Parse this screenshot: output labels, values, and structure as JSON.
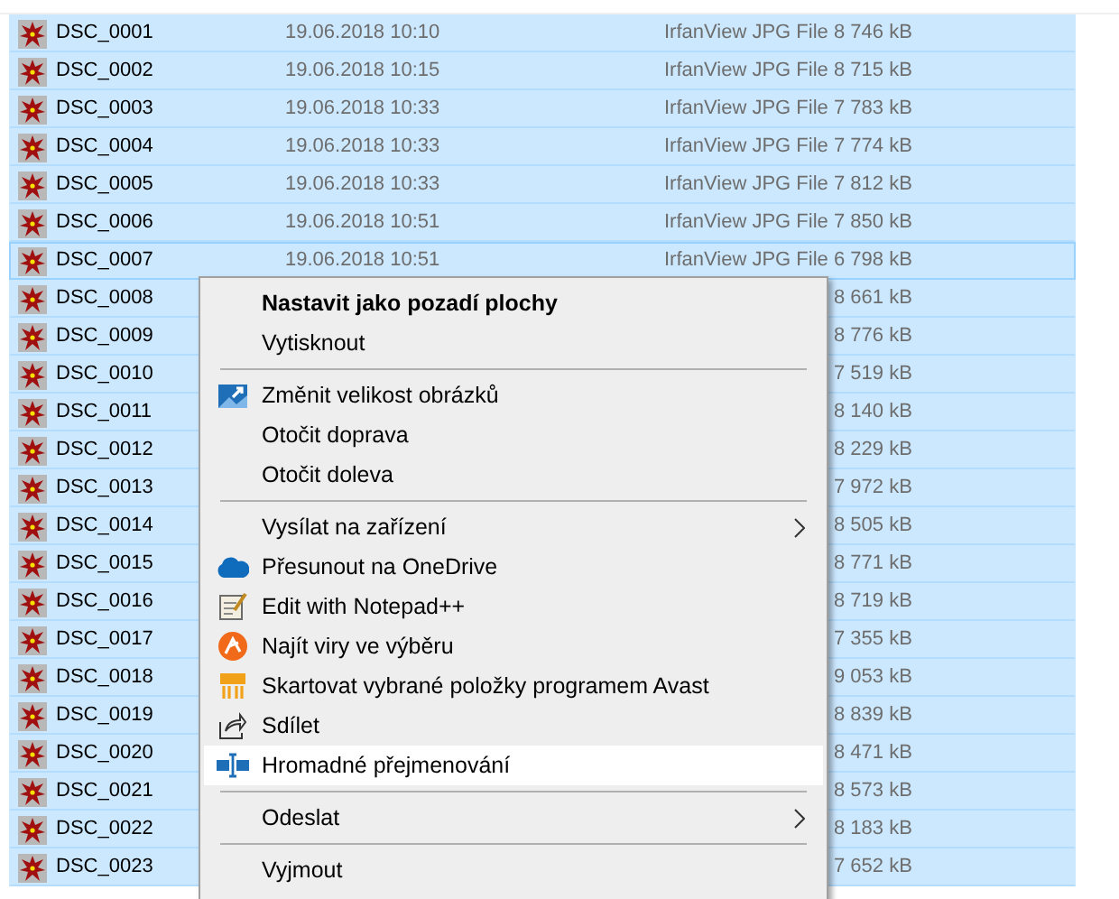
{
  "files": [
    {
      "name": "DSC_0001",
      "date": "19.06.2018 10:10",
      "type": "IrfanView JPG File",
      "size": "8 746 kB",
      "selected": true,
      "focused": false
    },
    {
      "name": "DSC_0002",
      "date": "19.06.2018 10:15",
      "type": "IrfanView JPG File",
      "size": "8 715 kB",
      "selected": true,
      "focused": false
    },
    {
      "name": "DSC_0003",
      "date": "19.06.2018 10:33",
      "type": "IrfanView JPG File",
      "size": "7 783 kB",
      "selected": true,
      "focused": false
    },
    {
      "name": "DSC_0004",
      "date": "19.06.2018 10:33",
      "type": "IrfanView JPG File",
      "size": "7 774 kB",
      "selected": true,
      "focused": false
    },
    {
      "name": "DSC_0005",
      "date": "19.06.2018 10:33",
      "type": "IrfanView JPG File",
      "size": "7 812 kB",
      "selected": true,
      "focused": false
    },
    {
      "name": "DSC_0006",
      "date": "19.06.2018 10:51",
      "type": "IrfanView JPG File",
      "size": "7 850 kB",
      "selected": true,
      "focused": false
    },
    {
      "name": "DSC_0007",
      "date": "19.06.2018 10:51",
      "type": "IrfanView JPG File",
      "size": "6 798 kB",
      "selected": true,
      "focused": true
    },
    {
      "name": "DSC_0008",
      "size": "8 661 kB",
      "selected": true,
      "focused": false
    },
    {
      "name": "DSC_0009",
      "size": "8 776 kB",
      "selected": true,
      "focused": false
    },
    {
      "name": "DSC_0010",
      "size": "7 519 kB",
      "selected": true,
      "focused": false
    },
    {
      "name": "DSC_0011",
      "size": "8 140 kB",
      "selected": true,
      "focused": false
    },
    {
      "name": "DSC_0012",
      "size": "8 229 kB",
      "selected": true,
      "focused": false
    },
    {
      "name": "DSC_0013",
      "size": "7 972 kB",
      "selected": true,
      "focused": false
    },
    {
      "name": "DSC_0014",
      "size": "8 505 kB",
      "selected": true,
      "focused": false
    },
    {
      "name": "DSC_0015",
      "size": "8 771 kB",
      "selected": true,
      "focused": false
    },
    {
      "name": "DSC_0016",
      "size": "8 719 kB",
      "selected": true,
      "focused": false
    },
    {
      "name": "DSC_0017",
      "size": "7 355 kB",
      "selected": true,
      "focused": false
    },
    {
      "name": "DSC_0018",
      "size": "9 053 kB",
      "selected": true,
      "focused": false
    },
    {
      "name": "DSC_0019",
      "size": "8 839 kB",
      "selected": true,
      "focused": false
    },
    {
      "name": "DSC_0020",
      "size": "8 471 kB",
      "selected": true,
      "focused": false
    },
    {
      "name": "DSC_0021",
      "size": "8 573 kB",
      "selected": true,
      "focused": false
    },
    {
      "name": "DSC_0022",
      "size": "8 183 kB",
      "selected": true,
      "focused": false
    },
    {
      "name": "DSC_0023",
      "size": "7 652 kB",
      "selected": true,
      "focused": false
    }
  ],
  "context_menu": [
    {
      "kind": "item",
      "label": "Nastavit jako pozadí plochy",
      "bold": true,
      "submenu": false,
      "selected": false
    },
    {
      "kind": "item",
      "label": "Vytisknout",
      "bold": false,
      "submenu": false,
      "selected": false
    },
    {
      "kind": "separator"
    },
    {
      "kind": "item",
      "label": "Změnit velikost obrázků",
      "bold": false,
      "submenu": false,
      "selected": false
    },
    {
      "kind": "item",
      "label": "Otočit doprava",
      "bold": false,
      "submenu": false,
      "selected": false
    },
    {
      "kind": "item",
      "label": "Otočit doleva",
      "bold": false,
      "submenu": false,
      "selected": false
    },
    {
      "kind": "separator"
    },
    {
      "kind": "item",
      "label": "Vysílat na zařízení",
      "bold": false,
      "submenu": true,
      "selected": false
    },
    {
      "kind": "item",
      "label": "Přesunout na OneDrive",
      "bold": false,
      "submenu": false,
      "selected": false
    },
    {
      "kind": "item",
      "label": "Edit with Notepad++",
      "bold": false,
      "submenu": false,
      "selected": false
    },
    {
      "kind": "item",
      "label": "Najít viry ve výběru",
      "bold": false,
      "submenu": false,
      "selected": false
    },
    {
      "kind": "item",
      "label": "Skartovat vybrané položky programem Avast",
      "bold": false,
      "submenu": false,
      "selected": false
    },
    {
      "kind": "item",
      "label": "Sdílet",
      "bold": false,
      "submenu": false,
      "selected": false
    },
    {
      "kind": "item",
      "label": "Hromadné přejmenování",
      "bold": false,
      "submenu": false,
      "selected": true
    },
    {
      "kind": "separator"
    },
    {
      "kind": "item",
      "label": "Odeslat",
      "bold": false,
      "submenu": true,
      "selected": false
    },
    {
      "kind": "separator"
    },
    {
      "kind": "item",
      "label": "Vyjmout",
      "bold": false,
      "submenu": false,
      "selected": false
    }
  ]
}
